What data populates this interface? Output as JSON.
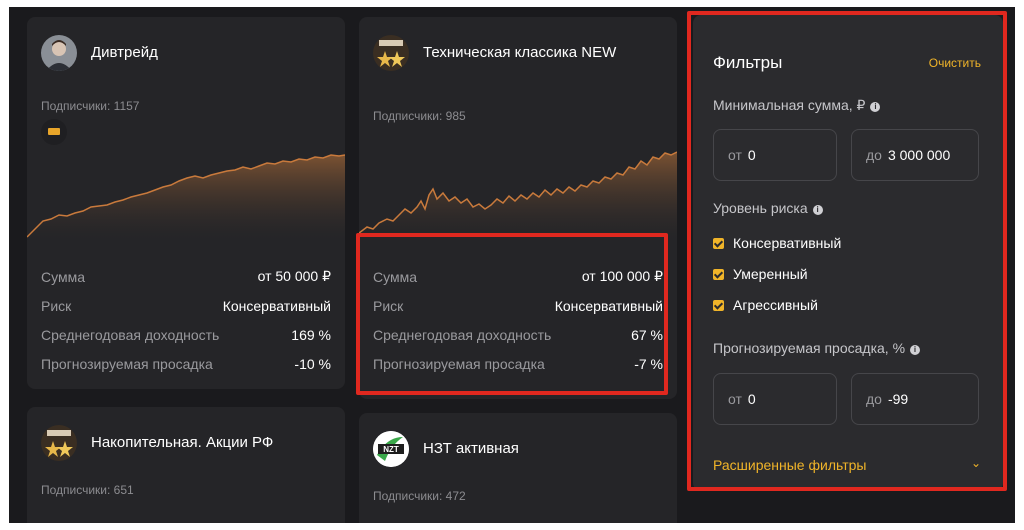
{
  "colors": {
    "accent": "#f0b429",
    "highlight": "#e0281f",
    "chart_line": "#c97a3c",
    "background": "#1a1a1d"
  },
  "strategies": [
    {
      "title": "Дивтрейд",
      "subscribers": "Подписчики: 1157",
      "avatar_icon": "person-photo-icon",
      "stats": [
        {
          "label": "Сумма",
          "value": "от 50 000 ₽"
        },
        {
          "label": "Риск",
          "value": "Консервативный"
        },
        {
          "label": "Среднегодовая доходность",
          "value": "169 %"
        },
        {
          "label": "Прогнозируемая просадка",
          "value": "-10 %"
        }
      ]
    },
    {
      "title": "Техническая классика NEW",
      "subscribers": "Подписчики: 985",
      "avatar_icon": "stars-icon",
      "stats": [
        {
          "label": "Сумма",
          "value": "от 100 000 ₽"
        },
        {
          "label": "Риск",
          "value": "Консервативный"
        },
        {
          "label": "Среднегодовая доходность",
          "value": "67 %"
        },
        {
          "label": "Прогнозируемая просадка",
          "value": "-7 %"
        }
      ]
    },
    {
      "title": "Накопительная. Акции РФ",
      "subscribers": "Подписчики: 651",
      "avatar_icon": "stars-icon"
    },
    {
      "title": "НЗТ активная",
      "subscribers": "Подписчики: 472",
      "avatar_icon": "nzt-logo-icon",
      "logo_text": "NZT"
    }
  ],
  "filters": {
    "title": "Фильтры",
    "clear": "Очистить",
    "min_sum": {
      "label": "Минимальная сумма, ₽",
      "from_prefix": "от",
      "from_value": "0",
      "to_prefix": "до",
      "to_value": "3 000 000"
    },
    "risk": {
      "label": "Уровень риска",
      "options": [
        "Консервативный",
        "Умеренный",
        "Агрессивный"
      ]
    },
    "drawdown": {
      "label": "Прогнозируемая просадка, %",
      "from_prefix": "от",
      "from_value": "0",
      "to_prefix": "до",
      "to_value": "-99"
    },
    "advanced": "Расширенные фильтры"
  }
}
